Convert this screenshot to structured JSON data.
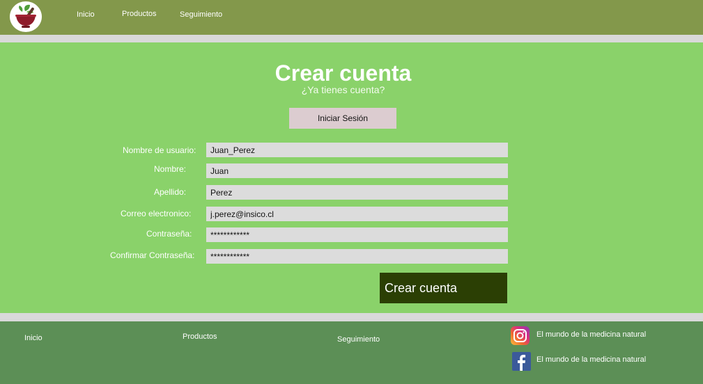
{
  "header": {
    "nav": [
      "Inicio",
      "Productos",
      "Seguimiento"
    ]
  },
  "main": {
    "title": "Crear cuenta",
    "subtitle": "¿Ya tienes cuenta?",
    "login_button": "Iniciar Sesión",
    "fields": [
      {
        "label": "Nombre de usuario:",
        "value": "Juan_Perez"
      },
      {
        "label": "Nombre:",
        "value": "Juan"
      },
      {
        "label": "Apellido:",
        "value": "Perez"
      },
      {
        "label": "Correo electronico:",
        "value": "j.perez@insico.cl"
      },
      {
        "label": "Contraseña:",
        "value": "************"
      },
      {
        "label": "Confirmar Contraseña:",
        "value": "************"
      }
    ],
    "submit_button": "Crear cuenta"
  },
  "footer": {
    "links": [
      "Inicio",
      "Productos",
      "Seguimiento"
    ],
    "social": [
      {
        "icon": "instagram-icon",
        "text": "El mundo de la medicina natural"
      },
      {
        "icon": "facebook-icon",
        "text": "El mundo de la medicina natural"
      }
    ]
  },
  "colors": {
    "header": "#83984b",
    "main": "#8ad26a",
    "footer": "#5c8f56",
    "submit": "#2b3f04",
    "login": "#dcccd0",
    "input": "#dcdcdc"
  }
}
